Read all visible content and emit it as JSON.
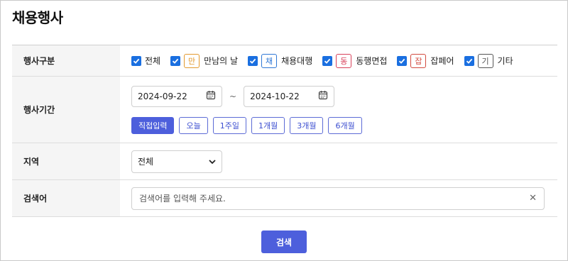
{
  "page": {
    "title": "채용행사"
  },
  "event_type": {
    "label": "행사구분",
    "options": [
      {
        "label": "전체",
        "checked": true,
        "badge": null
      },
      {
        "label": "만남의 날",
        "checked": true,
        "badge": "만",
        "badge_color": "#e39a2f"
      },
      {
        "label": "채용대행",
        "checked": true,
        "badge": "채",
        "badge_color": "#2f78d6"
      },
      {
        "label": "동행면접",
        "checked": true,
        "badge": "동",
        "badge_color": "#d9415a"
      },
      {
        "label": "잡페어",
        "checked": true,
        "badge": "잡",
        "badge_color": "#d24a3f"
      },
      {
        "label": "기타",
        "checked": true,
        "badge": "기",
        "badge_color": "#555555"
      }
    ]
  },
  "period": {
    "label": "행사기간",
    "start_date": "2024-09-22",
    "end_date": "2024-10-22",
    "separator": "~",
    "quick_buttons": [
      {
        "label": "직접입력",
        "active": true
      },
      {
        "label": "오늘",
        "active": false
      },
      {
        "label": "1주일",
        "active": false
      },
      {
        "label": "1개월",
        "active": false
      },
      {
        "label": "3개월",
        "active": false
      },
      {
        "label": "6개월",
        "active": false
      }
    ]
  },
  "region": {
    "label": "지역",
    "selected": "전체"
  },
  "keyword": {
    "label": "검색어",
    "placeholder": "검색어를 입력해 주세요.",
    "value": ""
  },
  "submit": {
    "label": "검색"
  },
  "colors": {
    "accent": "#4d5fdc",
    "checkbox": "#1a6fe0"
  }
}
